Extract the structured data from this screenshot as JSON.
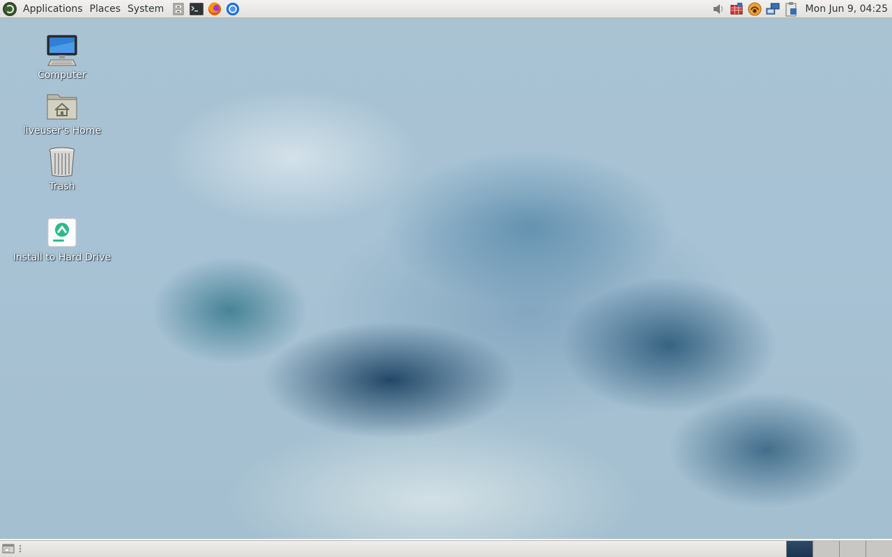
{
  "top_panel": {
    "menus": [
      "Applications",
      "Places",
      "System"
    ],
    "launchers": [
      "file-cabinet-icon",
      "terminal-icon",
      "firefox-icon",
      "thunderbird-icon"
    ],
    "tray_icons": [
      "volume-icon",
      "update-notifier-icon",
      "weather-icon",
      "network-icon",
      "clipboard-icon"
    ],
    "clock": "Mon Jun  9, 04:25"
  },
  "desktop": {
    "icons": [
      {
        "label": "Computer",
        "icon": "computer-icon"
      },
      {
        "label": "liveuser's Home",
        "icon": "home-folder-icon"
      },
      {
        "label": "Trash",
        "icon": "trash-icon"
      },
      {
        "label": "Install to Hard Drive",
        "icon": "installer-icon"
      }
    ]
  },
  "bottom_panel": {
    "workspaces": 4,
    "active_workspace": 1
  }
}
